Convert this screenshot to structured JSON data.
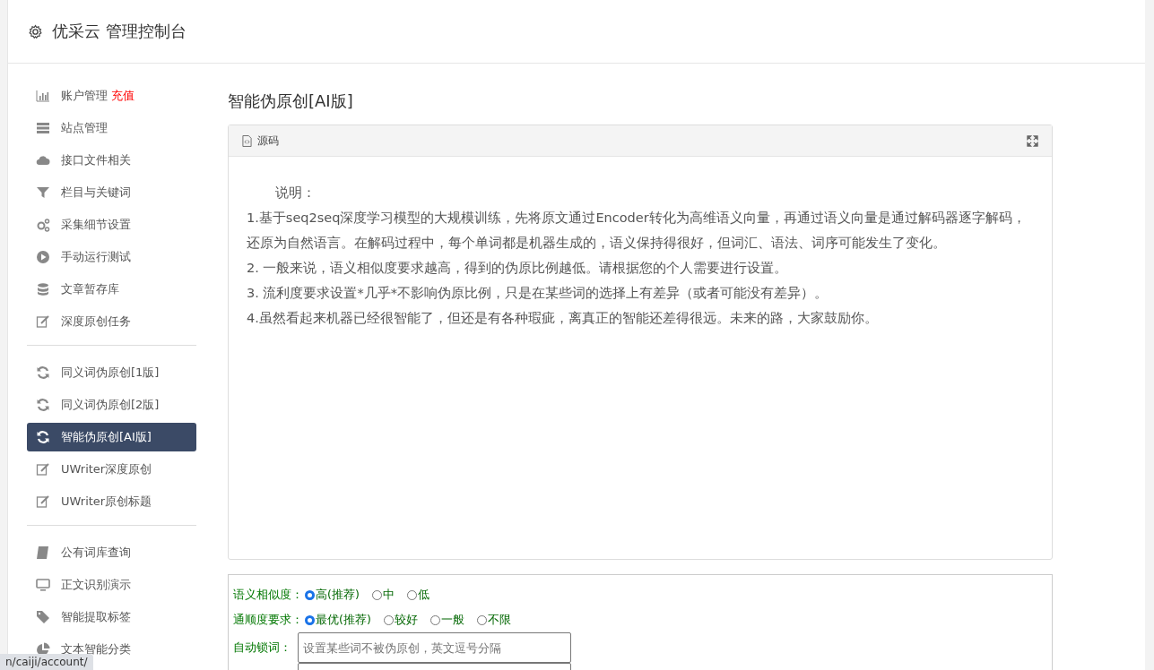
{
  "header": {
    "title": "优采云 管理控制台"
  },
  "sidebar": {
    "groups": [
      {
        "items": [
          {
            "label": "账户管理",
            "badge": "充值",
            "selected": false
          },
          {
            "label": "站点管理",
            "selected": false
          },
          {
            "label": "接口文件相关",
            "selected": false
          },
          {
            "label": "栏目与关键词",
            "selected": false
          },
          {
            "label": "采集细节设置",
            "selected": false
          },
          {
            "label": "手动运行测试",
            "selected": false
          },
          {
            "label": "文章暂存库",
            "selected": false
          },
          {
            "label": "深度原创任务",
            "selected": false
          }
        ]
      },
      {
        "items": [
          {
            "label": "同义词伪原创[1版]",
            "selected": false
          },
          {
            "label": "同义词伪原创[2版]",
            "selected": false
          },
          {
            "label": "智能伪原创[AI版]",
            "selected": true
          },
          {
            "label": "UWriter深度原创",
            "selected": false
          },
          {
            "label": "UWriter原创标题",
            "selected": false
          }
        ]
      },
      {
        "items": [
          {
            "label": "公有词库查询",
            "selected": false
          },
          {
            "label": "正文识别演示",
            "selected": false
          },
          {
            "label": "智能提取标签",
            "selected": false
          },
          {
            "label": "文本智能分类",
            "selected": false
          }
        ]
      }
    ]
  },
  "page_title": "智能伪原创[AI版]",
  "editor": {
    "tab": "源码",
    "lines": [
      "说明：",
      "1.基于seq2seq深度学习模型的大规模训练，先将原文通过Encoder转化为高维语义向量，再通过语义向量是通过解码器逐字解码，还原为自然语言。在解码过程中，每个单词都是机器生成的，语义保持得很好，但词汇、语法、词序可能发生了变化。",
      "2. 一般来说，语义相似度要求越高，得到的伪原比例越低。请根据您的个人需要进行设置。",
      "3. 流利度要求设置*几乎*不影响伪原比例，只是在某些词的选择上有差异（或者可能没有差异）。",
      "4.虽然看起来机器已经很智能了，但还是有各种瑕疵，离真正的智能还差得很远。未来的路，大家鼓励你。"
    ]
  },
  "options": [
    {
      "label": "语义相似度：",
      "choices": [
        {
          "label": "高(推荐)",
          "selected": true
        },
        {
          "label": "中",
          "selected": false
        },
        {
          "label": "低",
          "selected": false
        }
      ]
    },
    {
      "label": "通顺度要求：",
      "choices": [
        {
          "label": "最优(推荐)",
          "selected": true
        },
        {
          "label": "较好",
          "selected": false
        },
        {
          "label": "一般",
          "selected": false
        },
        {
          "label": "不限",
          "selected": false
        }
      ]
    }
  ],
  "lock_words": {
    "label": "自动锁词：",
    "placeholder": "设置某些词不被伪原创，英文逗号分隔"
  },
  "status_url": "n/caiji/account/"
}
